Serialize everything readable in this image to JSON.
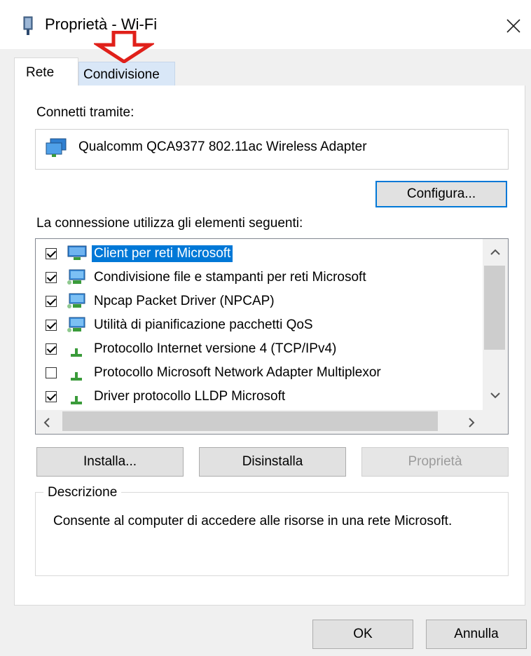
{
  "window": {
    "title": "Proprietà - Wi-Fi",
    "icon": "network-adapter-icon"
  },
  "tabs": [
    {
      "label": "Rete",
      "active": true
    },
    {
      "label": "Condivisione",
      "active": false
    }
  ],
  "annotation": {
    "arrow_color": "#e0201a",
    "target": "Condivisione"
  },
  "connect_via": {
    "label": "Connetti tramite:",
    "adapter": "Qualcomm QCA9377 802.11ac Wireless Adapter"
  },
  "configure_button": "Configura...",
  "items_label": "La connessione utilizza gli elementi seguenti:",
  "items": [
    {
      "label": "Client per reti Microsoft",
      "checked": true,
      "icon": "network-client-icon",
      "selected": true
    },
    {
      "label": "Condivisione file e stampanti per reti Microsoft",
      "checked": true,
      "icon": "network-service-icon",
      "selected": false
    },
    {
      "label": "Npcap Packet Driver (NPCAP)",
      "checked": true,
      "icon": "network-service-icon",
      "selected": false
    },
    {
      "label": "Utilità di pianificazione pacchetti QoS",
      "checked": true,
      "icon": "network-service-icon",
      "selected": false
    },
    {
      "label": "Protocollo Internet versione 4 (TCP/IPv4)",
      "checked": true,
      "icon": "protocol-icon",
      "selected": false
    },
    {
      "label": "Protocollo Microsoft Network Adapter Multiplexor",
      "checked": false,
      "icon": "protocol-icon",
      "selected": false
    },
    {
      "label": "Driver protocollo LLDP Microsoft",
      "checked": true,
      "icon": "protocol-icon",
      "selected": false
    }
  ],
  "buttons": {
    "install": "Installa...",
    "uninstall": "Disinstalla",
    "properties": "Proprietà"
  },
  "description": {
    "title": "Descrizione",
    "text": "Consente al computer di accedere alle risorse in una rete Microsoft."
  },
  "footer": {
    "ok": "OK",
    "cancel": "Annulla"
  },
  "colors": {
    "accent": "#0078d7",
    "selected_tab": "#d9e7f7"
  }
}
